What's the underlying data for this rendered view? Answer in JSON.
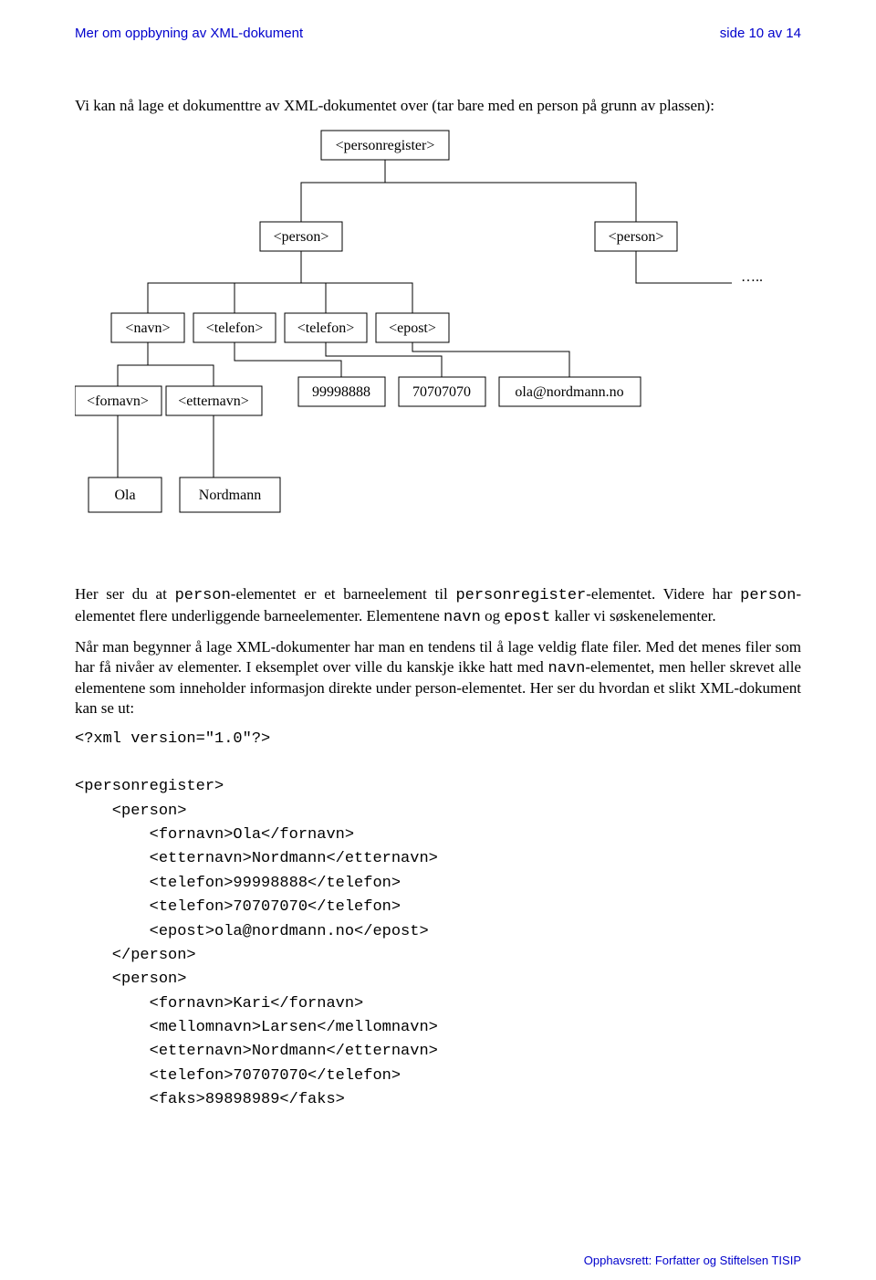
{
  "header": {
    "leftTitle": "Mer om oppbyning av XML-dokument",
    "rightTitle": "side 10 av 14"
  },
  "introText": "Vi kan nå lage et dokumenttre av XML-dokumentet over (tar bare med en person på grunn av plassen):",
  "chart_data": {
    "type": "diagram",
    "title": "XML document tree",
    "nodes": {
      "root": {
        "label": "<personregister>"
      },
      "person1": {
        "label": "<person>"
      },
      "person2": {
        "label": "<person>"
      },
      "ellipsis": {
        "label": "….."
      },
      "navn": {
        "label": "<navn>"
      },
      "telefon1": {
        "label": "<telefon>"
      },
      "telefon2": {
        "label": "<telefon>"
      },
      "epost": {
        "label": "<epost>"
      },
      "fornavn": {
        "label": "<fornavn>"
      },
      "etternavn": {
        "label": "<etternavn>"
      },
      "tel1val": {
        "label": "99998888"
      },
      "tel2val": {
        "label": "70707070"
      },
      "epostval": {
        "label": "ola@nordmann.no"
      },
      "fornval": {
        "label": "Ola"
      },
      "etterval": {
        "label": "Nordmann"
      }
    },
    "edges": [
      [
        "root",
        "person1"
      ],
      [
        "root",
        "person2"
      ],
      [
        "person1",
        "navn"
      ],
      [
        "person1",
        "telefon1"
      ],
      [
        "person1",
        "telefon2"
      ],
      [
        "person1",
        "epost"
      ],
      [
        "navn",
        "fornavn"
      ],
      [
        "navn",
        "etternavn"
      ],
      [
        "telefon1",
        "tel1val"
      ],
      [
        "telefon2",
        "tel2val"
      ],
      [
        "epost",
        "epostval"
      ],
      [
        "fornavn",
        "fornval"
      ],
      [
        "etternavn",
        "etterval"
      ]
    ]
  },
  "paragraphs": {
    "p1a": "Her ser du at ",
    "p1b": "-elementet er et barneelement til ",
    "p1c": "-elementet. Videre har ",
    "p1d": "-elementet flere underliggende barneelementer. Elementene ",
    "p1e": " og ",
    "p1f": " kaller vi søskenelementer.",
    "code_person": "person",
    "code_personregister": "personregister",
    "code_navn": "navn",
    "code_epost": "epost",
    "p2a": "Når man begynner å lage XML-dokumenter har man en tendens til å lage veldig flate filer. Med det menes filer som har få nivåer av elementer. I eksemplet over ville du kanskje ikke hatt med ",
    "p2b": "-elementet, men heller skrevet alle elementene som inneholder informasjon direkte under person-elementet. Her ser du hvordan et slikt XML-dokument kan se ut:"
  },
  "xmlCode": "<?xml version=\"1.0\"?>\n\n<personregister>\n    <person>\n        <fornavn>Ola</fornavn>\n        <etternavn>Nordmann</etternavn>\n        <telefon>99998888</telefon>\n        <telefon>70707070</telefon>\n        <epost>ola@nordmann.no</epost>\n    </person>\n    <person>\n        <fornavn>Kari</fornavn>\n        <mellomnavn>Larsen</mellomnavn>\n        <etternavn>Nordmann</etternavn>\n        <telefon>70707070</telefon>\n        <faks>89898989</faks>",
  "footer": "Opphavsrett:  Forfatter og Stiftelsen TISIP"
}
